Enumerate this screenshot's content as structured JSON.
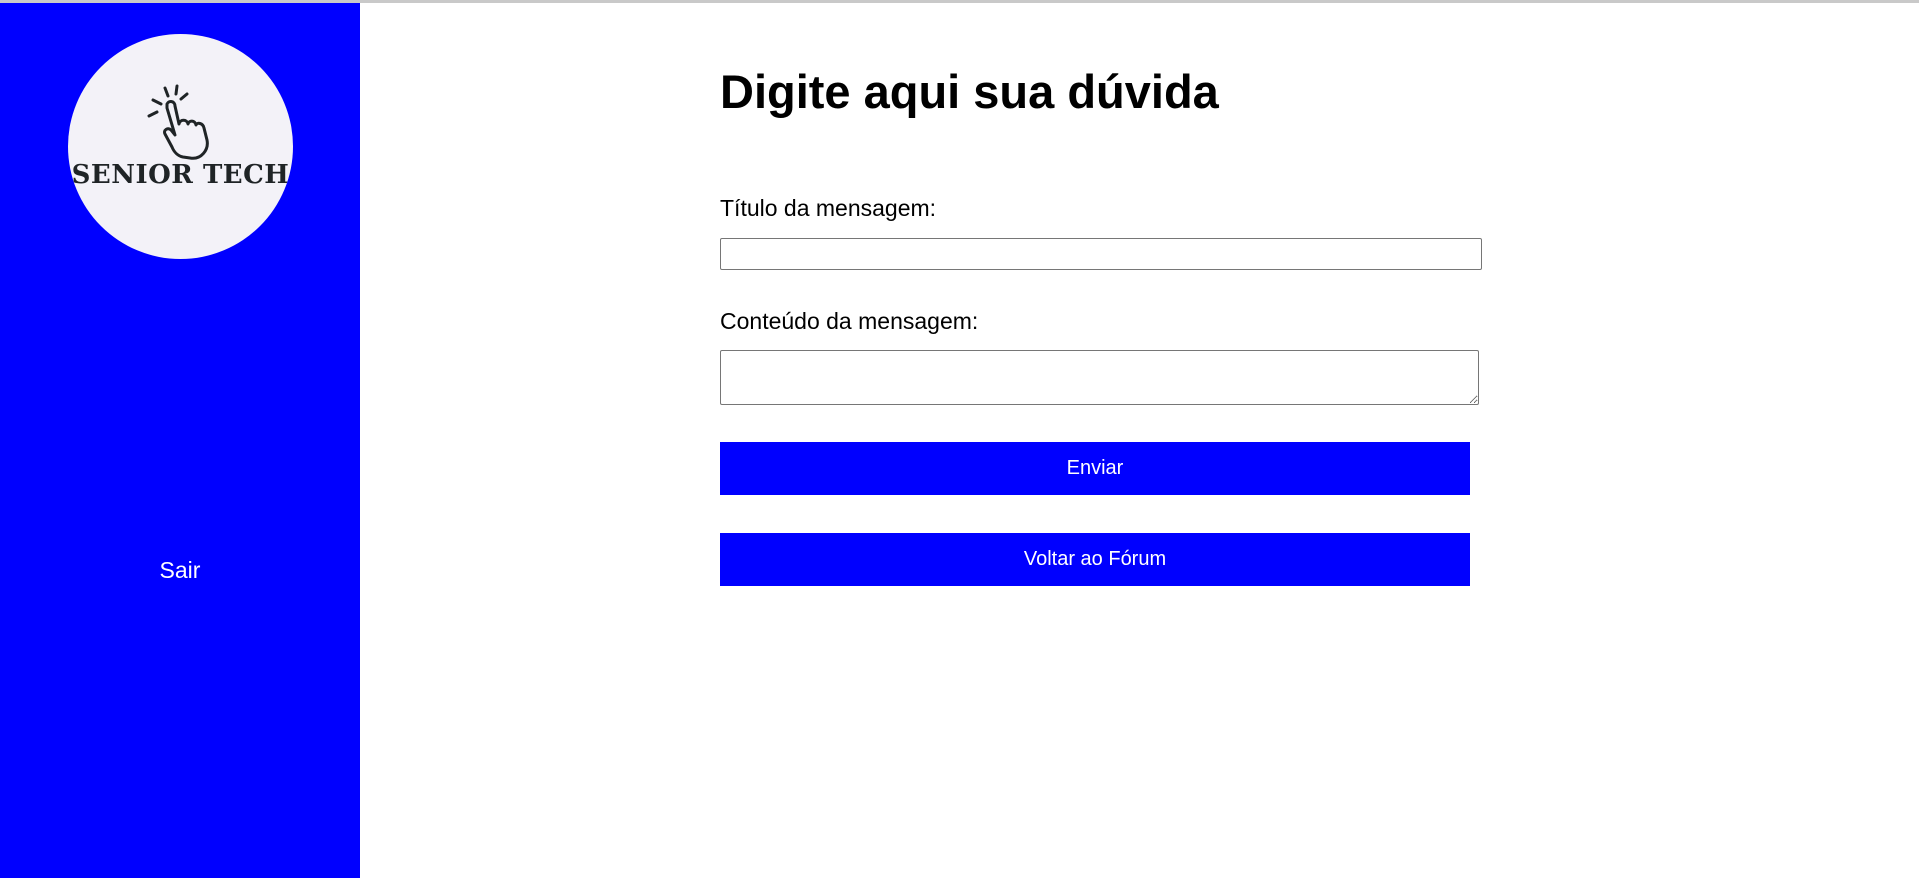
{
  "sidebar": {
    "logo": {
      "text": "SENIOR TECH",
      "icon": "pointing-hand-icon"
    },
    "items": [
      {
        "label": "Sair"
      }
    ]
  },
  "main": {
    "title": "Digite aqui sua dúvida",
    "form": {
      "title_label": "Título da mensagem:",
      "title_value": "",
      "content_label": "Conteúdo da mensagem:",
      "content_value": "",
      "send_label": "Enviar",
      "back_label": "Voltar ao Fórum"
    }
  },
  "colors": {
    "sidebar_bg": "#0000ff",
    "button_bg": "#0000ff",
    "logo_bg": "#f3f2f8"
  }
}
